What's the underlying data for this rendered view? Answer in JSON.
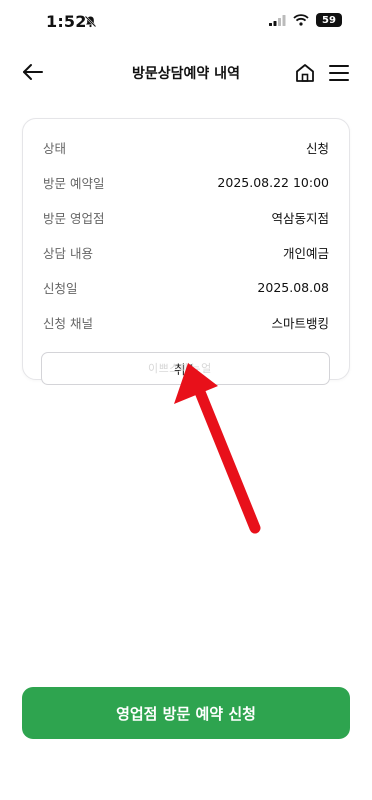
{
  "status_bar": {
    "time": "1:52",
    "battery": "59",
    "icons": [
      "bell-slash-icon",
      "signal-icon",
      "wifi-icon",
      "battery-icon"
    ]
  },
  "header": {
    "title": "방문상담예약 내역",
    "icons": [
      "back-arrow-icon",
      "home-icon",
      "menu-icon"
    ]
  },
  "details": [
    {
      "label": "상태",
      "value": "신청"
    },
    {
      "label": "방문 예약일",
      "value": "2025.08.22 10:00"
    },
    {
      "label": "방문 영업점",
      "value": "역삼동지점"
    },
    {
      "label": "상담 내용",
      "value": "개인예금"
    },
    {
      "label": "신청일",
      "value": "2025.08.08"
    },
    {
      "label": "신청 채널",
      "value": "스마트뱅킹"
    }
  ],
  "cancel_label": "취소",
  "watermark": "이쁘스매뉴얼",
  "cta_label": "영업점 방문 예약 신청",
  "colors": {
    "primary_green": "#2ea44f",
    "arrow_red": "#e8101a"
  }
}
